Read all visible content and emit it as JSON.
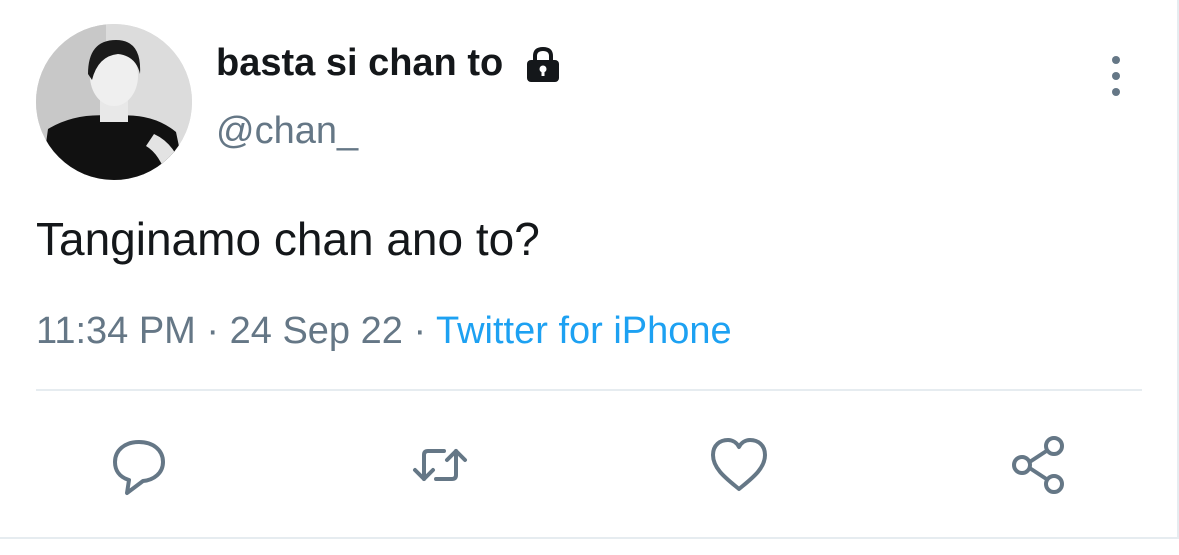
{
  "tweet": {
    "display_name": "basta si chan to",
    "handle": "@chan_",
    "text": "Tanginamo chan ano to?",
    "time": "11:34 PM",
    "date": "24 Sep 22",
    "source": "Twitter for iPhone",
    "protected_icon": "lock-icon"
  },
  "actions": {
    "reply_icon": "reply-icon",
    "retweet_icon": "retweet-icon",
    "like_icon": "heart-icon",
    "share_icon": "share-icon",
    "more_icon": "more-vertical-icon"
  },
  "colors": {
    "text": "#14171a",
    "secondary": "#657786",
    "link": "#1da1f2",
    "divider": "#e6ecf0"
  }
}
